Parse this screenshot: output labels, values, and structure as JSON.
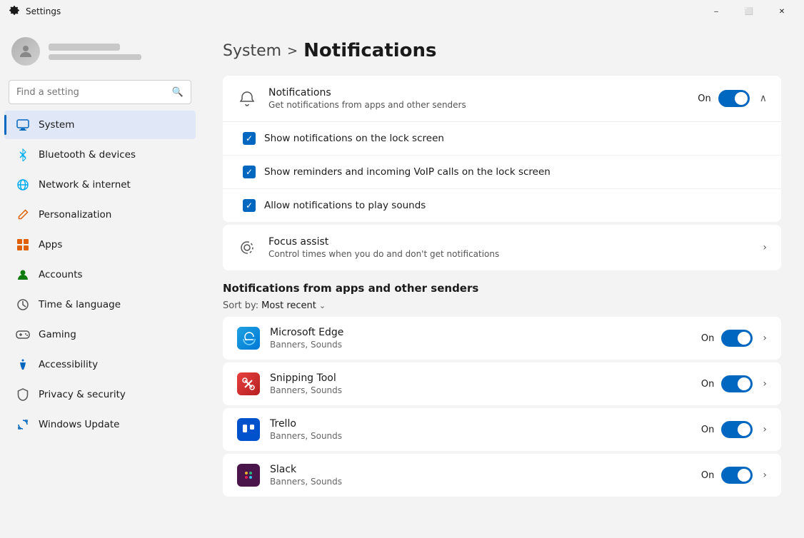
{
  "titlebar": {
    "title": "Settings",
    "minimize_label": "–",
    "maximize_label": "⬜",
    "close_label": "✕"
  },
  "sidebar": {
    "search_placeholder": "Find a setting",
    "user": {
      "name_blurred": true,
      "email_blurred": true
    },
    "nav_items": [
      {
        "id": "system",
        "label": "System",
        "icon": "🖥",
        "icon_color": "blue",
        "active": true
      },
      {
        "id": "bluetooth",
        "label": "Bluetooth & devices",
        "icon": "🔵",
        "icon_color": "light-blue",
        "active": false
      },
      {
        "id": "network",
        "label": "Network & internet",
        "icon": "🌐",
        "icon_color": "light-blue",
        "active": false
      },
      {
        "id": "personalization",
        "label": "Personalization",
        "icon": "✏",
        "icon_color": "orange",
        "active": false
      },
      {
        "id": "apps",
        "label": "Apps",
        "icon": "📦",
        "icon_color": "orange",
        "active": false
      },
      {
        "id": "accounts",
        "label": "Accounts",
        "icon": "👤",
        "icon_color": "green",
        "active": false
      },
      {
        "id": "time",
        "label": "Time & language",
        "icon": "🕐",
        "icon_color": "gray",
        "active": false
      },
      {
        "id": "gaming",
        "label": "Gaming",
        "icon": "🎮",
        "icon_color": "gray",
        "active": false
      },
      {
        "id": "accessibility",
        "label": "Accessibility",
        "icon": "♿",
        "icon_color": "blue",
        "active": false
      },
      {
        "id": "privacy",
        "label": "Privacy & security",
        "icon": "🛡",
        "icon_color": "gray",
        "active": false
      },
      {
        "id": "windows-update",
        "label": "Windows Update",
        "icon": "🔄",
        "icon_color": "blue",
        "active": false
      }
    ]
  },
  "main": {
    "breadcrumb_parent": "System",
    "breadcrumb_arrow": ">",
    "breadcrumb_current": "Notifications",
    "notifications_section": {
      "title": "Notifications",
      "subtitle": "Get notifications from apps and other senders",
      "status": "On",
      "toggle_on": true,
      "expanded": true,
      "checkboxes": [
        {
          "label": "Show notifications on the lock screen",
          "checked": true
        },
        {
          "label": "Show reminders and incoming VoIP calls on the lock screen",
          "checked": true
        },
        {
          "label": "Allow notifications to play sounds",
          "checked": true
        }
      ]
    },
    "focus_assist": {
      "title": "Focus assist",
      "subtitle": "Control times when you do and don't get notifications"
    },
    "apps_section": {
      "header": "Notifications from apps and other senders",
      "sort_label": "Sort by:",
      "sort_value": "Most recent",
      "apps": [
        {
          "id": "edge",
          "name": "Microsoft Edge",
          "subtitle": "Banners, Sounds",
          "status": "On",
          "toggle_on": true
        },
        {
          "id": "snipping",
          "name": "Snipping Tool",
          "subtitle": "Banners, Sounds",
          "status": "On",
          "toggle_on": true
        },
        {
          "id": "trello",
          "name": "Trello",
          "subtitle": "Banners, Sounds",
          "status": "On",
          "toggle_on": true
        },
        {
          "id": "slack",
          "name": "Slack",
          "subtitle": "Banners, Sounds",
          "status": "On",
          "toggle_on": true
        }
      ]
    }
  }
}
